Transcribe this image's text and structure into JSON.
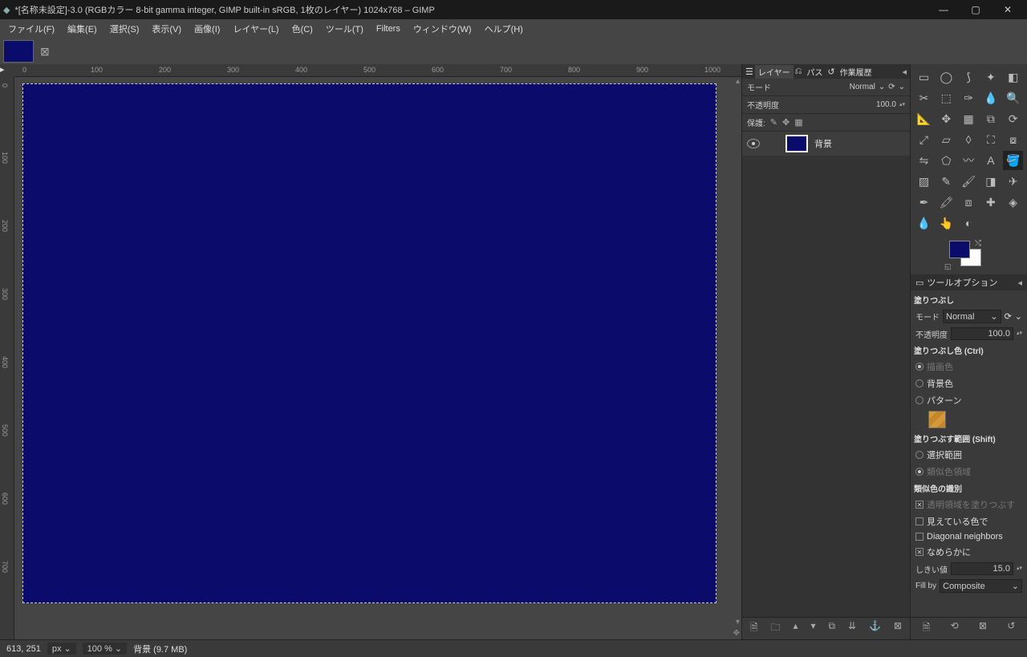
{
  "titlebar": {
    "title": "*[名称未設定]-3.0 (RGBカラー 8-bit gamma integer, GIMP built-in sRGB, 1枚のレイヤー) 1024x768 – GIMP"
  },
  "menu": {
    "file": "ファイル(F)",
    "edit": "編集(E)",
    "select": "選択(S)",
    "view": "表示(V)",
    "image": "画像(I)",
    "layer": "レイヤー(L)",
    "color": "色(C)",
    "tools": "ツール(T)",
    "filters": "Filters",
    "window": "ウィンドウ(W)",
    "help": "ヘルプ(H)"
  },
  "ruler_ticks": [
    "0",
    "100",
    "200",
    "300",
    "400",
    "500",
    "600",
    "700",
    "800",
    "900",
    "1000"
  ],
  "layers_panel": {
    "tab_layers": "レイヤー",
    "tab_paths": "パス",
    "tab_history": "作業履歴",
    "mode_label": "モード",
    "mode_value": "Normal",
    "opacity_label": "不透明度",
    "opacity_value": "100.0",
    "lock_label": "保護:",
    "layer_name": "背景"
  },
  "tool_options": {
    "header": "ツールオプション",
    "title": "塗りつぶし",
    "mode_label": "モード",
    "mode_value": "Normal",
    "opacity_label": "不透明度",
    "opacity_value": "100.0",
    "fill_color_hdr": "塗りつぶし色 (Ctrl)",
    "fg_color": "描画色",
    "bg_color": "背景色",
    "pattern": "パターン",
    "fill_area_hdr": "塗りつぶす範囲 (Shift)",
    "selection": "選択範囲",
    "similar": "類似色領域",
    "similar_hdr": "類似色の識別",
    "fill_transparent": "透明領域を塗りつぶす",
    "visible_color": "見えている色で",
    "diagonal": "Diagonal neighbors",
    "antialias": "なめらかに",
    "threshold_label": "しきい値",
    "threshold_value": "15.0",
    "fillby_label": "Fill by",
    "fillby_value": "Composite"
  },
  "statusbar": {
    "coords": "613, 251",
    "unit": "px",
    "zoom": "100 %",
    "status": "背景 (9.7 MB)"
  },
  "colors": {
    "fg": "#0b0b6b",
    "bg": "#ffffff"
  }
}
